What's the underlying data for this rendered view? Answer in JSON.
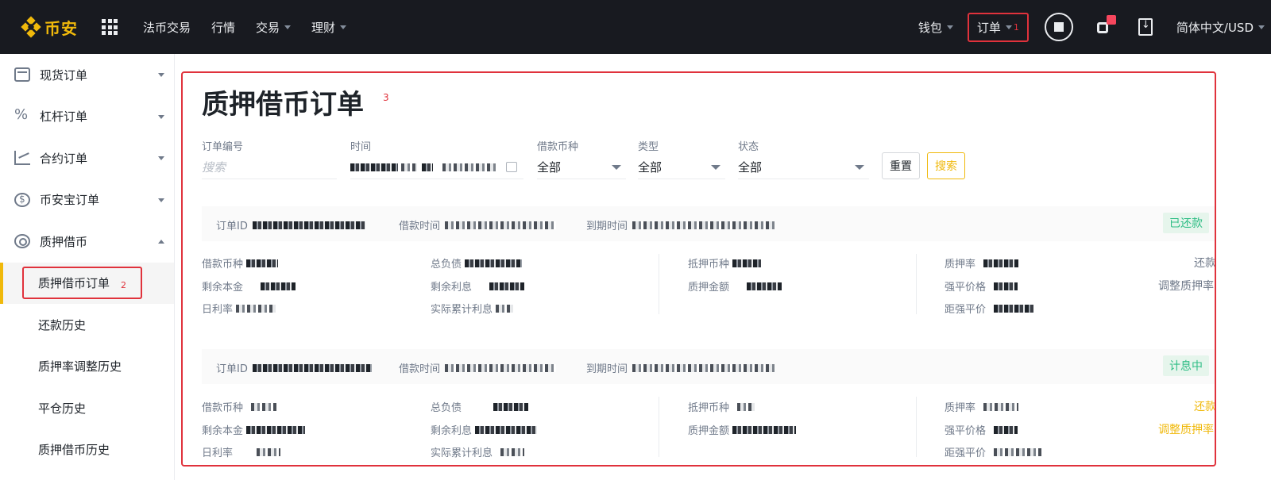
{
  "brand": {
    "name": "币安",
    "color": "#f0b90b"
  },
  "topnav": {
    "items": [
      {
        "label": "法币交易",
        "has_caret": false
      },
      {
        "label": "行情",
        "has_caret": false
      },
      {
        "label": "交易",
        "has_caret": true
      },
      {
        "label": "理财",
        "has_caret": true
      }
    ],
    "wallet": "钱包",
    "orders": "订单",
    "orders_annotation": "1",
    "language": "简体中文/USD"
  },
  "sidebar": {
    "items": [
      {
        "label": "现货订单",
        "icon": "wallet-icon"
      },
      {
        "label": "杠杆订单",
        "icon": "percent-icon"
      },
      {
        "label": "合约订单",
        "icon": "futures-chart-icon"
      },
      {
        "label": "币安宝订单",
        "icon": "earn-coin-icon"
      },
      {
        "label": "质押借币",
        "icon": "loan-icon"
      }
    ],
    "subitems": [
      {
        "label": "质押借币订单",
        "active": true,
        "annotation": "2"
      },
      {
        "label": "还款历史"
      },
      {
        "label": "质押率调整历史"
      },
      {
        "label": "平仓历史"
      },
      {
        "label": "质押借币历史"
      }
    ]
  },
  "main": {
    "title": "质押借币订单",
    "title_annotation": "3",
    "filters": {
      "order_id_label": "订单编号",
      "order_id_placeholder": "搜索",
      "time_label": "时间",
      "coin_label": "借款币种",
      "coin_value": "全部",
      "type_label": "类型",
      "type_value": "全部",
      "status_label": "状态",
      "status_value": "全部",
      "reset_label": "重置",
      "search_label": "搜索"
    },
    "orders": [
      {
        "order_id_label": "订单ID",
        "borrow_time_label": "借款时间",
        "expiry_label": "到期时间",
        "status": "已还款",
        "fields": {
          "loan_coin": "借款币种",
          "remaining_principal": "剩余本金",
          "daily_rate": "日利率",
          "total_debt": "总负债",
          "remaining_interest": "剩余利息",
          "actual_interest": "实际累计利息",
          "collateral_coin": "抵押币种",
          "collateral_amount": "质押金额",
          "ltv": "质押率",
          "liq_price": "强平价格",
          "to_liq": "距强平价"
        },
        "actions": {
          "repay": "还款",
          "adjust": "调整质押率"
        }
      },
      {
        "order_id_label": "订单ID",
        "borrow_time_label": "借款时间",
        "expiry_label": "到期时间",
        "status": "计息中",
        "fields": {
          "loan_coin": "借款币种",
          "remaining_principal": "剩余本金",
          "daily_rate": "日利率",
          "total_debt": "总负债",
          "remaining_interest": "剩余利息",
          "actual_interest": "实际累计利息",
          "collateral_coin": "抵押币种",
          "collateral_amount": "质押金额",
          "ltv": "质押率",
          "liq_price": "强平价格",
          "to_liq": "距强平价"
        },
        "actions": {
          "repay": "还款",
          "adjust": "调整质押率"
        }
      }
    ]
  }
}
